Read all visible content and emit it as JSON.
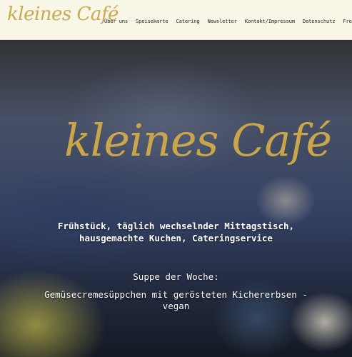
{
  "header": {
    "logo_text": "kleines Café",
    "nav": [
      {
        "label": "Über uns"
      },
      {
        "label": "Speisekarte"
      },
      {
        "label": "Catering"
      },
      {
        "label": "Newsletter"
      },
      {
        "label": "Kontakt/Impressum"
      },
      {
        "label": "Datenschutz"
      },
      {
        "label": "Freunde"
      }
    ]
  },
  "hero": {
    "title": "kleines Café",
    "tagline_line1": "Frühstück, täglich wechselnder Mittagstisch,",
    "tagline_line2": "hausgemachte Kuchen, Cateringservice",
    "soup_heading": "Suppe der Woche:",
    "soup_line1": "Gemüsecremesüppchen mit gerösteten Kichererbsen -",
    "soup_line2": "vegan"
  },
  "colors": {
    "header_bg": "#f8f6e6",
    "gold": "#c9a951",
    "nav_text": "#2a2a2a"
  }
}
